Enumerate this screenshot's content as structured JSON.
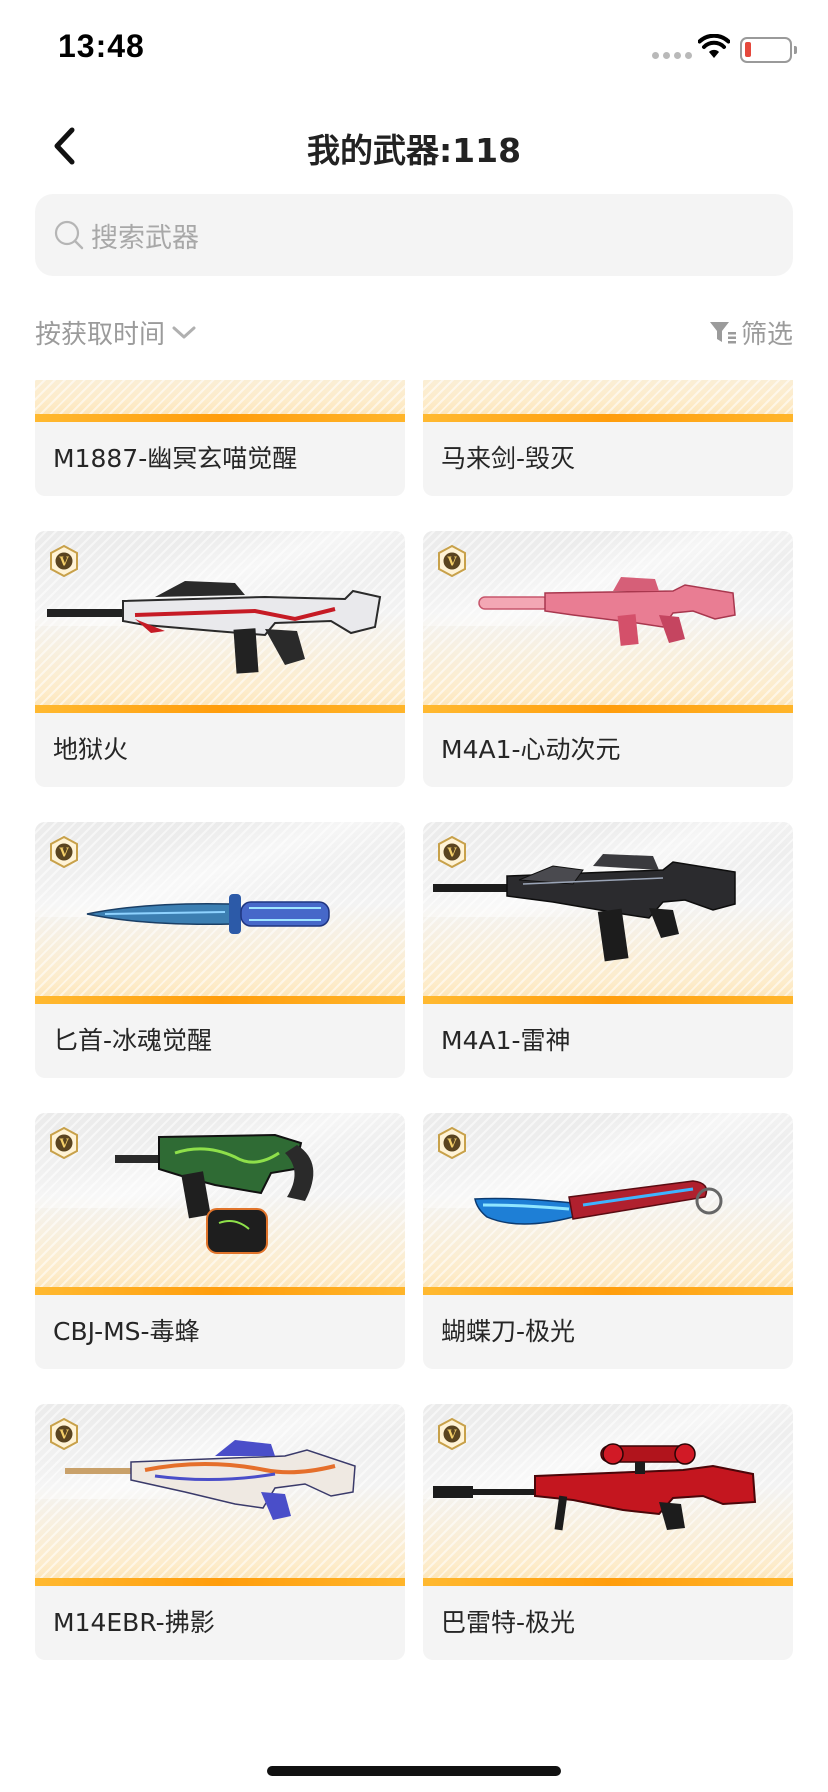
{
  "status_bar": {
    "time": "13:48",
    "battery_color": "#e5483c"
  },
  "nav": {
    "title": "我的武器:118",
    "back_icon": "chevron-left-icon"
  },
  "search": {
    "placeholder": "搜索武器",
    "icon": "search-icon"
  },
  "sort": {
    "label": "按获取时间",
    "icon": "chevron-down-icon"
  },
  "filter": {
    "label": "筛选",
    "icon": "funnel-icon"
  },
  "accent_colors": {
    "bar": "#ff9d0c",
    "badge": "#c8a14a"
  },
  "weapons": [
    {
      "name": "M1887-幽冥玄喵觉醒",
      "vip": false,
      "icon": "shotgun-icon"
    },
    {
      "name": "马来剑-毁灭",
      "vip": false,
      "icon": "kris-sword-icon"
    },
    {
      "name": "地狱火",
      "vip": true,
      "icon": "assault-rifle-icon"
    },
    {
      "name": "M4A1-心动次元",
      "vip": true,
      "icon": "rifle-pink-icon"
    },
    {
      "name": "匕首-冰魂觉醒",
      "vip": true,
      "icon": "dagger-icon"
    },
    {
      "name": "M4A1-雷神",
      "vip": true,
      "icon": "rifle-black-icon"
    },
    {
      "name": "CBJ-MS-毒蜂",
      "vip": true,
      "icon": "smg-icon"
    },
    {
      "name": "蝴蝶刀-极光",
      "vip": true,
      "icon": "butterfly-knife-icon"
    },
    {
      "name": "M14EBR-拂影",
      "vip": true,
      "icon": "marksman-rifle-icon"
    },
    {
      "name": "巴雷特-极光",
      "vip": true,
      "icon": "sniper-rifle-icon"
    }
  ]
}
